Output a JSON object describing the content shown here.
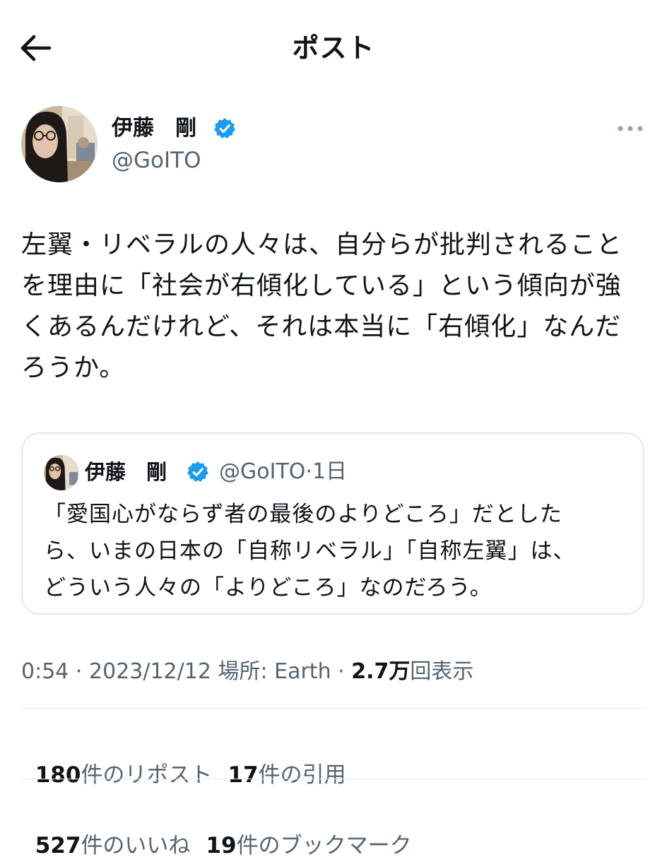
{
  "header": {
    "title": "ポスト"
  },
  "author": {
    "name": "伊藤　剛",
    "handle": "@GoITO",
    "verified": true,
    "avatar_icon": "avatar-photo-icon"
  },
  "tweet": {
    "text": "左翼・リベラルの人々は、自分らが批判されること\nを理由に「社会が右傾化している」という傾向が強\nくあるんだけれど、それは本当に「右傾化」なんだ\nろうか。"
  },
  "quote": {
    "name": "伊藤　剛",
    "handle": "@GoITO",
    "separator": "·",
    "time": "1日",
    "text": "「愛国心がならず者の最後のよりどころ」だとした\nら、いまの日本の「自称リベラル」「自称左翼」は、\nどういう人々の「よりどころ」なのだろう。"
  },
  "meta": {
    "time": "0:54",
    "separator": "·",
    "date": "2023/12/12",
    "location_label": "場所: Earth",
    "views_count": "2.7万",
    "views_label": "回表示"
  },
  "stats": {
    "reposts": {
      "count": "180",
      "label": "件のリポスト"
    },
    "quotes": {
      "count": "17",
      "label": "件の引用"
    },
    "likes": {
      "count": "527",
      "label": "件のいいね"
    },
    "bookmarks": {
      "count": "19",
      "label": "件のブックマーク"
    }
  },
  "colors": {
    "text": "#0f1419",
    "secondary": "#536471",
    "verified_blue": "#1d9bf0",
    "border": "#e1e8ed"
  }
}
